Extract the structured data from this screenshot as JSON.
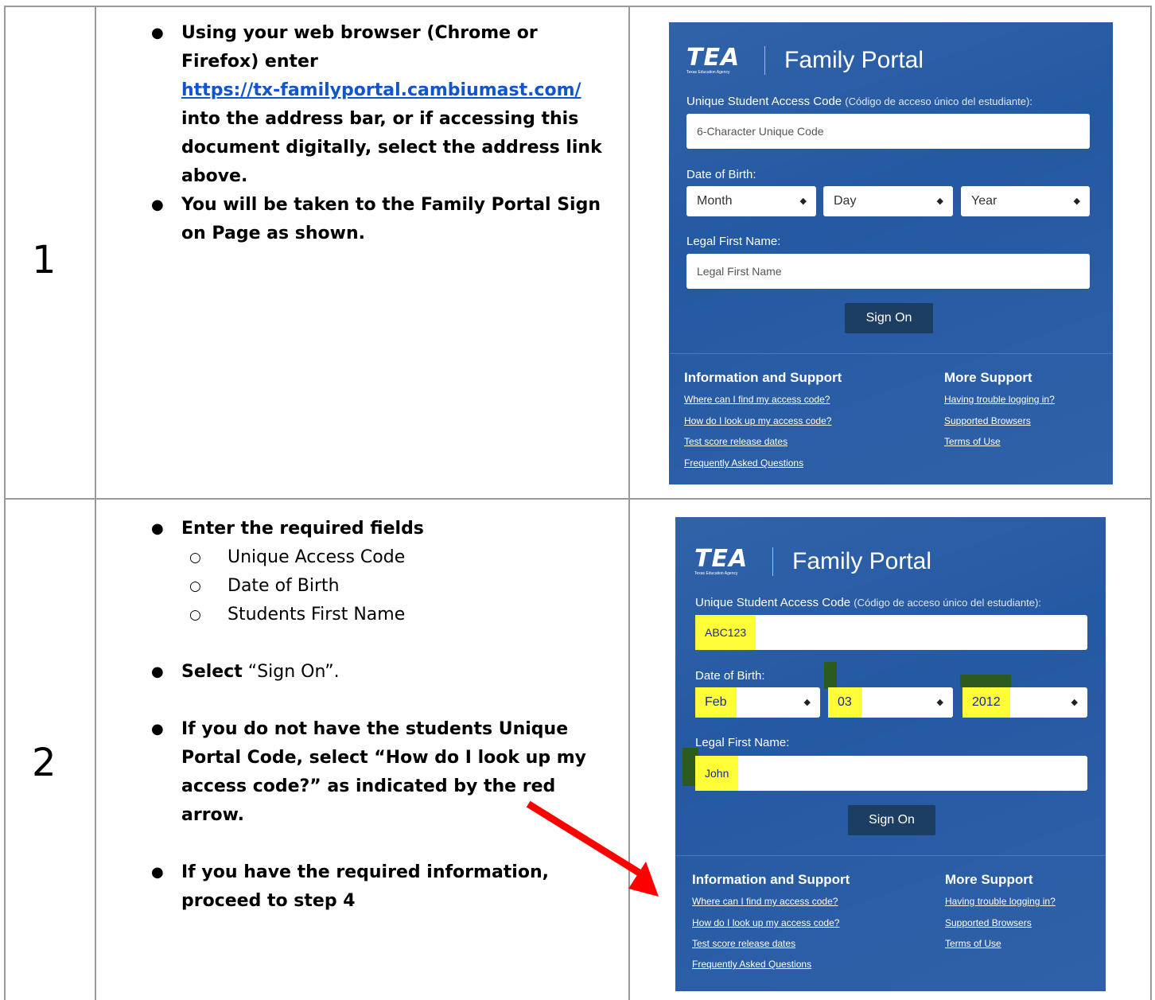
{
  "steps": [
    {
      "number": "1",
      "instructions": {
        "bullet1_pre": "Using your web browser (Chrome or Firefox) enter",
        "bullet1_link": "https://tx-familyportal.cambiumast.com/",
        "bullet1_post": "into the address bar, or if accessing this document digitally, select the address link above.",
        "bullet2": "You will be taken to the Family Portal Sign on Page as shown."
      },
      "portal": {
        "logo_text": "TEA",
        "logo_subtext": "Texas Education Agency",
        "title": "Family Portal",
        "code_label": "Unique Student Access Code",
        "code_label_es": "(Código de acceso único del estudiante):",
        "code_placeholder": "6-Character Unique Code",
        "dob_label": "Date of Birth:",
        "month": "Month",
        "day": "Day",
        "year": "Year",
        "name_label": "Legal First Name:",
        "name_placeholder": "Legal First Name",
        "sign_on": "Sign On",
        "info_title": "Information and Support",
        "info_links": [
          "Where can I find my access code?",
          "How do I look up my access code?",
          "Test score release dates",
          "Frequently Asked Questions"
        ],
        "more_title": "More Support",
        "more_links": [
          "Having trouble logging in?",
          "Supported Browsers",
          "Terms of Use"
        ]
      }
    },
    {
      "number": "2",
      "instructions": {
        "bullet1": "Enter the required fields",
        "subitems": [
          "Unique Access Code",
          "Date of Birth",
          "Students First Name"
        ],
        "bullet2_bold": "Select",
        "bullet2_rest": " “Sign On”.",
        "bullet3": "If you do not have the students Unique Portal Code, select “How do I look up my access code?” as indicated by the red arrow.",
        "bullet4": "If you have the required information, proceed to step 4"
      },
      "portal": {
        "logo_text": "TEA",
        "logo_subtext": "Texas Education Agency",
        "title": "Family Portal",
        "code_label": "Unique Student Access Code",
        "code_label_es": "(Código de acceso único del estudiante):",
        "code_value": "ABC123",
        "dob_label": "Date of Birth:",
        "month": "Feb",
        "day": "03",
        "year": "2012",
        "name_label": "Legal First Name:",
        "name_value": "John",
        "sign_on": "Sign On",
        "info_title": "Information and Support",
        "info_links": [
          "Where can I find my access code?",
          "How do I look up my access code?",
          "Test score release dates",
          "Frequently Asked Questions"
        ],
        "more_title": "More Support",
        "more_links": [
          "Having trouble logging in?",
          "Supported Browsers",
          "Terms of Use"
        ]
      }
    }
  ],
  "colors": {
    "portal_bg": "#2459a3",
    "button_bg": "#1b3e62",
    "link": "#1155cc",
    "highlight": "#fffd38",
    "arrow": "#ff0000"
  }
}
